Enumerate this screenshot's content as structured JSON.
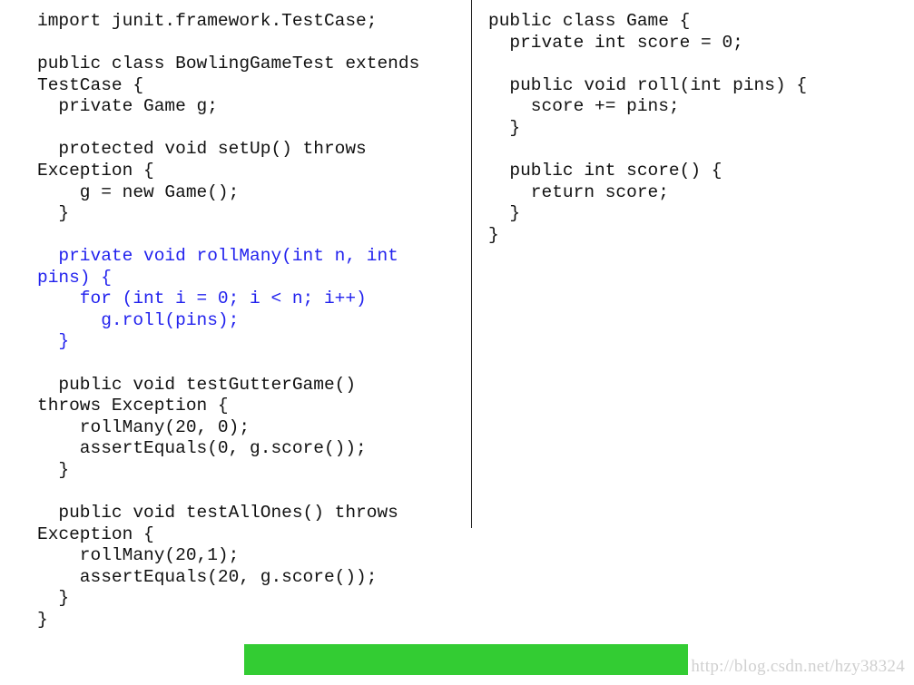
{
  "left_code": [
    {
      "text": "import junit.framework.TestCase;",
      "highlight": false
    },
    {
      "text": "",
      "highlight": false
    },
    {
      "text": "public class BowlingGameTest extends",
      "highlight": false
    },
    {
      "text": "TestCase {",
      "highlight": false
    },
    {
      "text": "  private Game g;",
      "highlight": false
    },
    {
      "text": "",
      "highlight": false
    },
    {
      "text": "  protected void setUp() throws",
      "highlight": false
    },
    {
      "text": "Exception {",
      "highlight": false
    },
    {
      "text": "    g = new Game();",
      "highlight": false
    },
    {
      "text": "  }",
      "highlight": false
    },
    {
      "text": "",
      "highlight": false
    },
    {
      "text": "  private void rollMany(int n, int",
      "highlight": true
    },
    {
      "text": "pins) {",
      "highlight": true
    },
    {
      "text": "    for (int i = 0; i < n; i++)",
      "highlight": true
    },
    {
      "text": "      g.roll(pins);",
      "highlight": true
    },
    {
      "text": "  }",
      "highlight": true
    },
    {
      "text": "",
      "highlight": false
    },
    {
      "text": "  public void testGutterGame()",
      "highlight": false
    },
    {
      "text": "throws Exception {",
      "highlight": false
    },
    {
      "text": "    rollMany(20, 0);",
      "highlight": false
    },
    {
      "text": "    assertEquals(0, g.score());",
      "highlight": false
    },
    {
      "text": "  }",
      "highlight": false
    },
    {
      "text": "",
      "highlight": false
    },
    {
      "text": "  public void testAllOnes() throws",
      "highlight": false
    },
    {
      "text": "Exception {",
      "highlight": false
    },
    {
      "text": "    rollMany(20,1);",
      "highlight": false
    },
    {
      "text": "    assertEquals(20, g.score());",
      "highlight": false
    },
    {
      "text": "  }",
      "highlight": false
    },
    {
      "text": "}",
      "highlight": false
    }
  ],
  "right_code": [
    {
      "text": "public class Game {",
      "highlight": false
    },
    {
      "text": "  private int score = 0;",
      "highlight": false
    },
    {
      "text": "",
      "highlight": false
    },
    {
      "text": "  public void roll(int pins) {",
      "highlight": false
    },
    {
      "text": "    score += pins;",
      "highlight": false
    },
    {
      "text": "  }",
      "highlight": false
    },
    {
      "text": "",
      "highlight": false
    },
    {
      "text": "  public int score() {",
      "highlight": false
    },
    {
      "text": "    return score;",
      "highlight": false
    },
    {
      "text": "  }",
      "highlight": false
    },
    {
      "text": "}",
      "highlight": false
    }
  ],
  "colors": {
    "highlight": "#2222ee",
    "bar": "#33cc33"
  },
  "watermark": "http://blog.csdn.net/hzy38324"
}
